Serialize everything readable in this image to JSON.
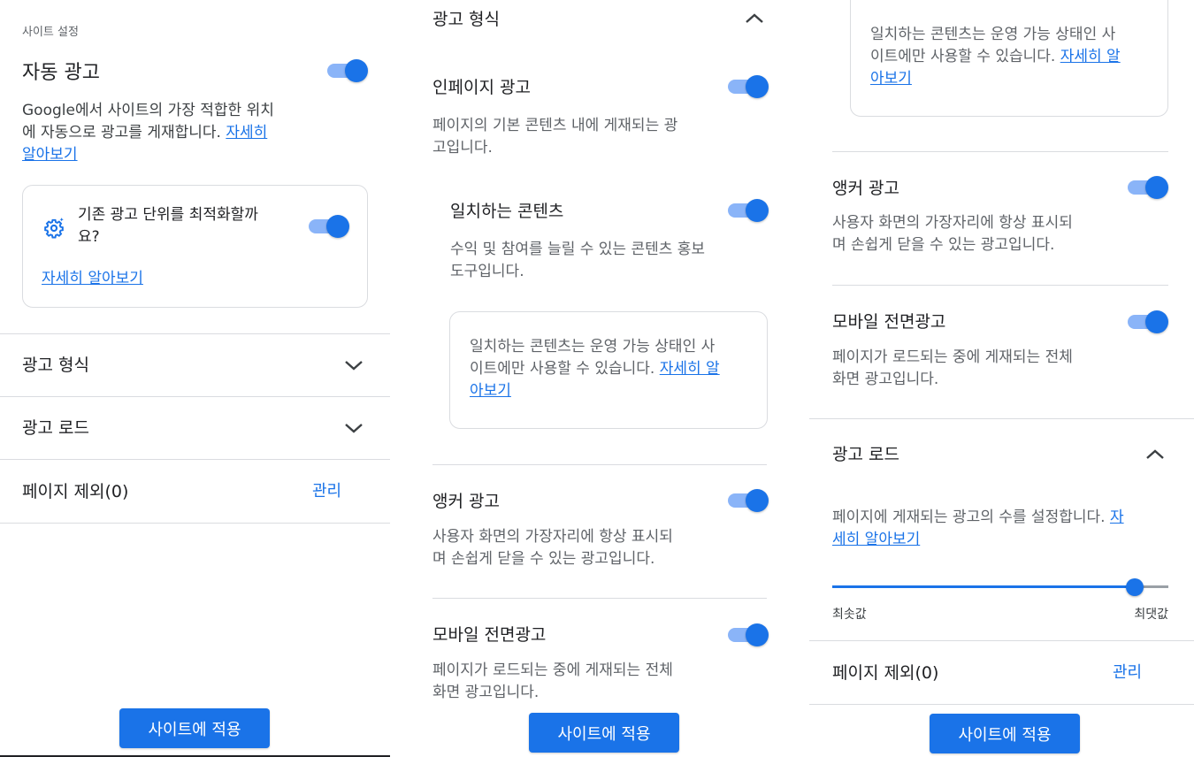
{
  "p1": {
    "section_label": "사이트 설정",
    "auto_ads_title": "자동 광고",
    "auto_ads_desc_line1": "Google에서 사이트의 가장 적합한 위치",
    "auto_ads_desc_line2": "에 자동으로 광고를 게재합니다. ",
    "learn_more_a": "자세히",
    "learn_more_b": "알아보기",
    "optimize_line1": "기존 광고 단위를 최적화할까",
    "optimize_line2": "요?",
    "optimize_learn_more": "자세히 알아보기",
    "ad_formats": "광고 형식",
    "ad_load": "광고 로드",
    "page_exclusions": "페이지 제외(0)",
    "manage": "관리",
    "apply": "사이트에 적용"
  },
  "p2": {
    "ad_formats": "광고 형식",
    "inpage_title": "인페이지 광고",
    "inpage_desc_line1": "페이지의 기본 콘텐츠 내에 게재되는 광",
    "inpage_desc_line2": "고입니다.",
    "matched_title": "일치하는 콘텐츠",
    "matched_desc_line1": "수익 및 참여를 늘릴 수 있는 콘텐츠 홍보",
    "matched_desc_line2": "도구입니다.",
    "matched_note_line1": "일치하는 콘텐츠는 운영 가능 상태인 사",
    "matched_note_line2": "이트에만 사용할 수 있습니다. ",
    "matched_note_link_a": "자세히 알",
    "matched_note_link_b": "아보기",
    "anchor_title": "앵커 광고",
    "anchor_desc_line1": "사용자 화면의 가장자리에 항상 표시되",
    "anchor_desc_line2": "며 손쉽게 닫을 수 있는 광고입니다.",
    "vignette_title": "모바일 전면광고",
    "vignette_desc_line1": "페이지가 로드되는 중에 게재되는 전체",
    "vignette_desc_line2": "화면 광고입니다.",
    "apply": "사이트에 적용"
  },
  "p3": {
    "note_line1": "일치하는 콘텐츠는 운영 가능 상태인 사",
    "note_line2": "이트에만 사용할 수 있습니다. ",
    "note_link_a": "자세히 알",
    "note_link_b": "아보기",
    "anchor_title": "앵커 광고",
    "anchor_desc_line1": "사용자 화면의 가장자리에 항상 표시되",
    "anchor_desc_line2": "며 손쉽게 닫을 수 있는 광고입니다.",
    "vignette_title": "모바일 전면광고",
    "vignette_desc_line1": "페이지가 로드되는 중에 게재되는 전체",
    "vignette_desc_line2": "화면 광고입니다.",
    "ad_load": "광고 로드",
    "ad_load_desc_line1": "페이지에 게재되는 광고의 수를 설정합니다. ",
    "ad_load_link_a": "자",
    "ad_load_link_b": "세히 알아보기",
    "slider_min": "최솟값",
    "slider_max": "최댓값",
    "slider_value_fraction": 0.9,
    "page_exclusions": "페이지 제외(0)",
    "manage": "관리",
    "apply": "사이트에 적용"
  },
  "colors": {
    "accent": "#1a73e8",
    "toggle_track": "#8ab4f8",
    "divider": "#dadce0"
  }
}
